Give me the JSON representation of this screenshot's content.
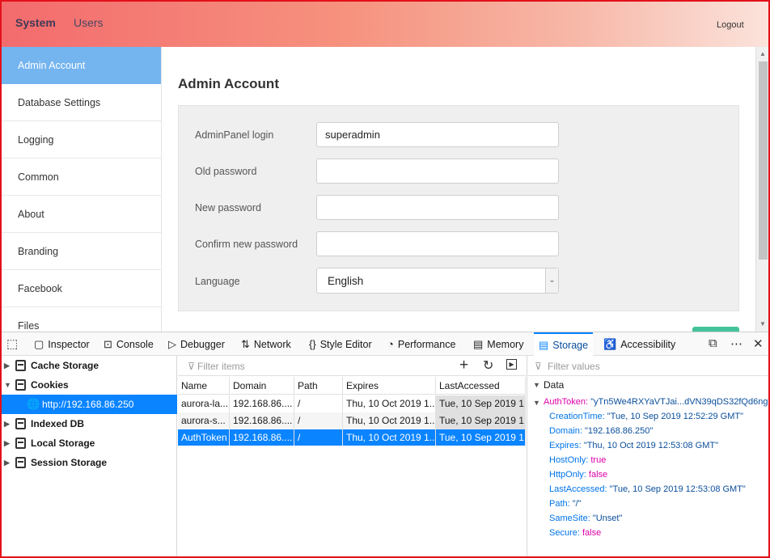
{
  "app": {
    "nav": {
      "system": "System",
      "users": "Users",
      "logout": "Logout"
    },
    "menu": [
      "Admin Account",
      "Database Settings",
      "Logging",
      "Common",
      "About",
      "Branding",
      "Facebook",
      "Files"
    ],
    "page_title": "Admin Account",
    "form": {
      "login_label": "AdminPanel login",
      "login_value": "superadmin",
      "old_label": "Old password",
      "new_label": "New password",
      "confirm_label": "Confirm new password",
      "language_label": "Language",
      "language_value": "English"
    }
  },
  "devtools": {
    "tabs": [
      "Inspector",
      "Console",
      "Debugger",
      "Network",
      "Style Editor",
      "Performance",
      "Memory",
      "Storage",
      "Accessibility"
    ],
    "active_tab": "Storage",
    "tree": [
      "Cache Storage",
      "Cookies",
      "http://192.168.86.250",
      "Indexed DB",
      "Local Storage",
      "Session Storage"
    ],
    "filter_items_placeholder": "Filter items",
    "filter_values_placeholder": "Filter values",
    "columns": [
      "Name",
      "Domain",
      "Path",
      "Expires",
      "LastAccessed"
    ],
    "rows": [
      [
        "aurora-la...",
        "192.168.86....",
        "/",
        "Thu, 10 Oct 2019 1...",
        "Tue, 10 Sep 2019 1..."
      ],
      [
        "aurora-s...",
        "192.168.86....",
        "/",
        "Thu, 10 Oct 2019 1...",
        "Tue, 10 Sep 2019 1..."
      ],
      [
        "AuthToken",
        "192.168.86....",
        "/",
        "Thu, 10 Oct 2019 1...",
        "Tue, 10 Sep 2019 1..."
      ]
    ],
    "data": {
      "heading": "Data",
      "root_key": "AuthToken",
      "root_value": "\"yTn5We4RXYaVTJai...dVN39qDS32fQd6ng\"",
      "props": [
        {
          "k": "CreationTime",
          "v": "\"Tue, 10 Sep 2019 12:52:29 GMT\"",
          "t": "s"
        },
        {
          "k": "Domain",
          "v": "\"192.168.86.250\"",
          "t": "s"
        },
        {
          "k": "Expires",
          "v": "\"Thu, 10 Oct 2019 12:53:08 GMT\"",
          "t": "s"
        },
        {
          "k": "HostOnly",
          "v": "true",
          "t": "b"
        },
        {
          "k": "HttpOnly",
          "v": "false",
          "t": "b"
        },
        {
          "k": "LastAccessed",
          "v": "\"Tue, 10 Sep 2019 12:53:08 GMT\"",
          "t": "s"
        },
        {
          "k": "Path",
          "v": "\"/\"",
          "t": "s"
        },
        {
          "k": "SameSite",
          "v": "\"Unset\"",
          "t": "s"
        },
        {
          "k": "Secure",
          "v": "false",
          "t": "b"
        }
      ]
    }
  },
  "colors": {
    "accent": "#0a84ff",
    "menu_active": "#74b4ef",
    "frame": "#e3101a",
    "green_button": "#42c39b"
  }
}
